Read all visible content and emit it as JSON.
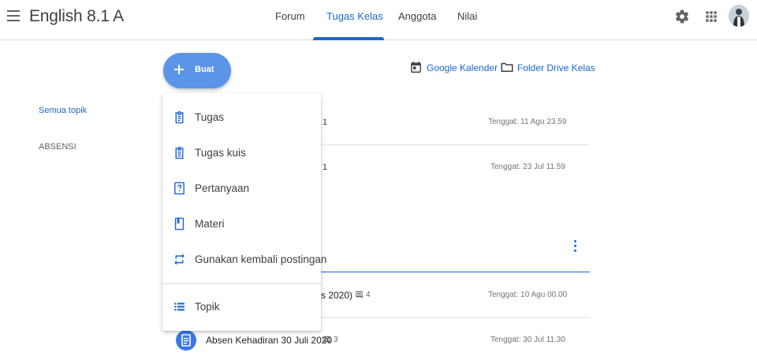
{
  "app": {
    "title": "English 8.1 A"
  },
  "tabs": [
    {
      "label": "Forum"
    },
    {
      "label": "Tugas Kelas"
    },
    {
      "label": "Anggota"
    },
    {
      "label": "Nilai"
    }
  ],
  "header_links": {
    "calendar": "Google Kalender",
    "drive": "Folder Drive Kelas"
  },
  "create_button": {
    "label": "Buat"
  },
  "sidebar": {
    "items": [
      {
        "label": "Semua topik"
      },
      {
        "label": "ABSENSI"
      }
    ]
  },
  "create_menu": {
    "items": [
      {
        "label": "Tugas",
        "icon": "assignment-icon"
      },
      {
        "label": "Tugas kuis",
        "icon": "quiz-assignment-icon"
      },
      {
        "label": "Pertanyaan",
        "icon": "question-icon"
      },
      {
        "label": "Materi",
        "icon": "material-icon"
      },
      {
        "label": "Gunakan kembali postingan",
        "icon": "reuse-post-icon"
      },
      {
        "label": "Topik",
        "icon": "topic-icon"
      }
    ]
  },
  "rows": [
    {
      "fragment": "1",
      "due": "Tenggat: 11 Agu 23.59"
    },
    {
      "fragment": "1",
      "due": "Tenggat: 23 Jul 11.59"
    },
    {
      "fragment": "s 2020)",
      "comments": "4",
      "due": "Tenggat: 10 Agu 00.00"
    },
    {
      "title": "Absen Kehadiran 30 Juli 2020",
      "comments": "3",
      "due": "Tenggat: 30 Jul 11.30"
    }
  ],
  "colors": {
    "accent": "#1967d2",
    "button": "#5b95e8"
  }
}
